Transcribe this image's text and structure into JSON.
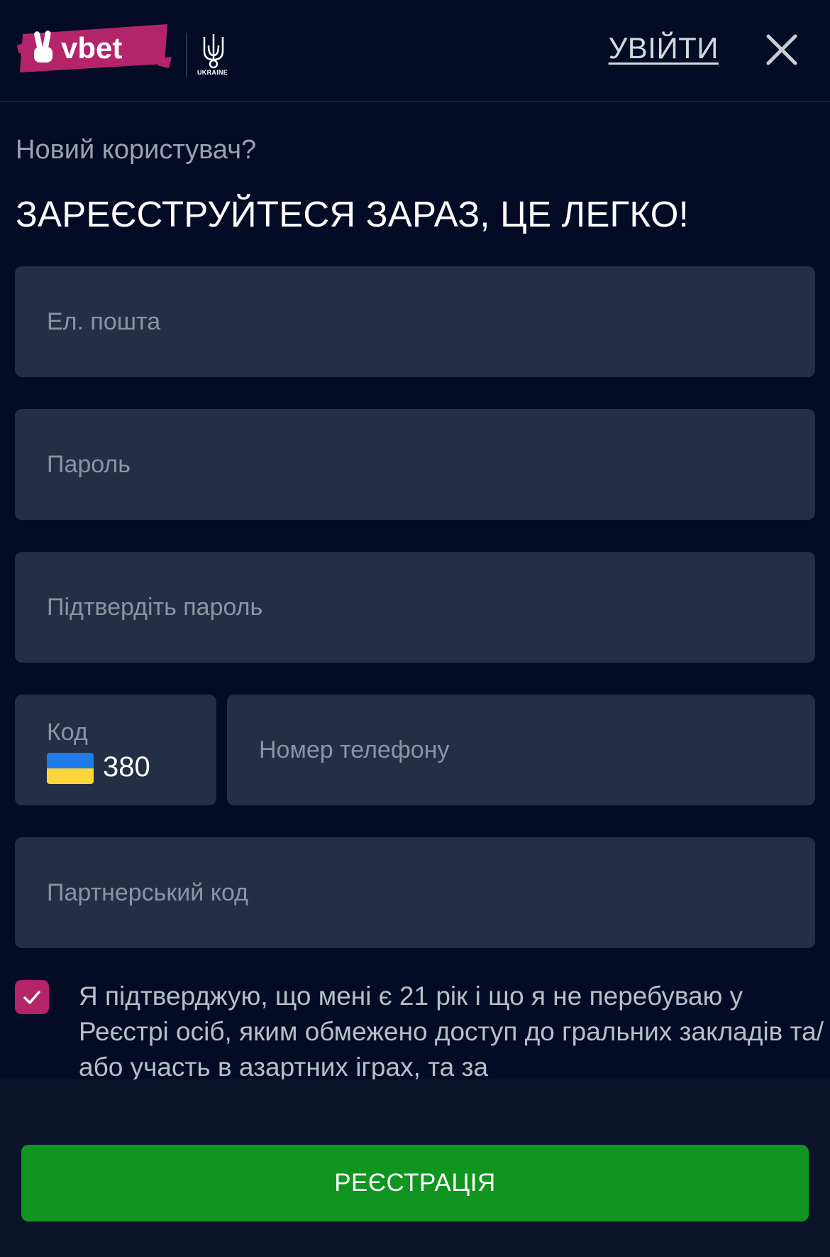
{
  "header": {
    "brand": "vbet",
    "partner_label": "UKRAINE",
    "login_label": "УВІЙТИ"
  },
  "form": {
    "subtitle": "Новий користувач?",
    "title": "ЗАРЕЄСТРУЙТЕСЯ ЗАРАЗ, ЦЕ ЛЕГКО!",
    "email_placeholder": "Ел. пошта",
    "password_placeholder": "Пароль",
    "confirm_password_placeholder": "Підтвердіть пароль",
    "code_label": "Код",
    "code_value": "380",
    "phone_placeholder": "Номер телефону",
    "partner_code_placeholder": "Партнерський код",
    "consent_text": "Я підтверджую, що мені є 21 рік і що я не перебуваю у Реєстрі осіб, яким обмежено доступ до гральних закладів та/або участь в азартних іграх, та за",
    "consent_checked": true,
    "register_label": "РЕЄСТРАЦІЯ"
  },
  "colors": {
    "background": "#030c24",
    "field": "#232f44",
    "brand_pink": "#b4246b",
    "button_green": "#119521"
  },
  "icons": {
    "close": "close-icon",
    "checkmark": "checkmark-icon",
    "flag": "ukraine-flag-icon",
    "emblem": "trident-emblem-icon"
  }
}
